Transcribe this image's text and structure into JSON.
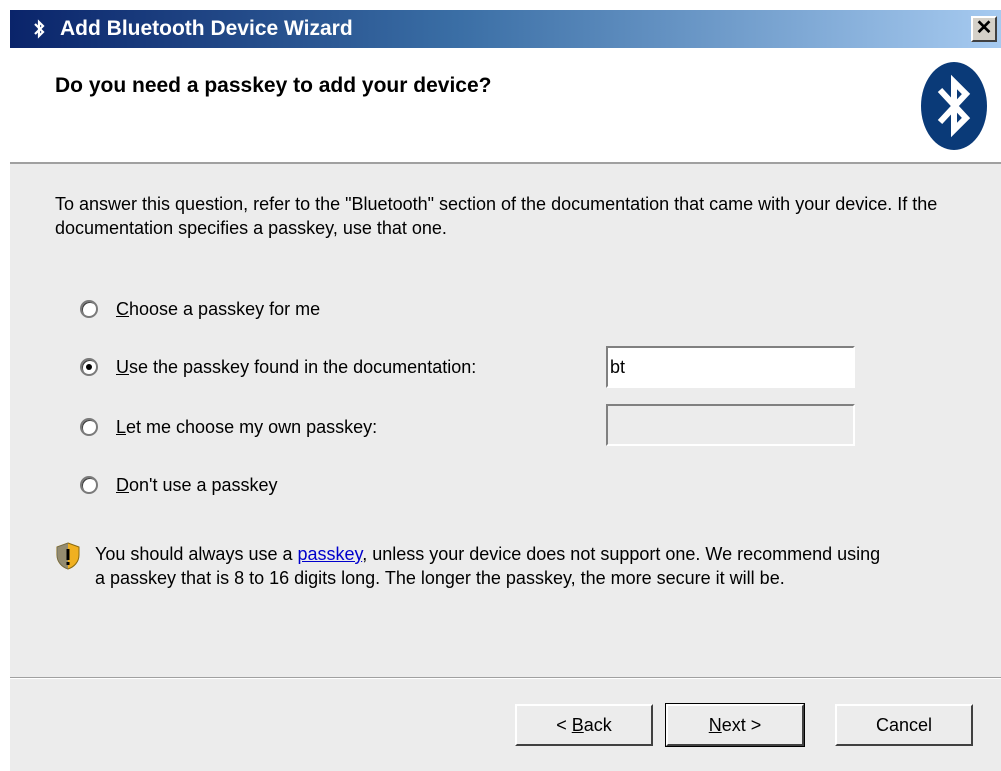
{
  "window": {
    "title": "Add Bluetooth Device Wizard",
    "close_glyph": "✕"
  },
  "header": {
    "question": "Do you need a passkey to add your device?",
    "logo_icon": "bluetooth-icon"
  },
  "body": {
    "intro": "To answer this question, refer to the \"Bluetooth\" section of the documentation that came with your device. If the documentation specifies a passkey, use that one.",
    "options": [
      {
        "accel": "C",
        "rest": "hoose a passkey for me",
        "checked": false
      },
      {
        "accel": "U",
        "rest": "se the passkey found in the documentation:",
        "checked": true
      },
      {
        "accel": "L",
        "rest": "et me choose my own passkey:",
        "checked": false
      },
      {
        "accel": "D",
        "pre": "",
        "rest": "on't use a passkey",
        "checked": false
      }
    ],
    "doc_passkey_value": "bt",
    "own_passkey_value": "",
    "notice_pre": "You should always use a ",
    "notice_link": "passkey",
    "notice_post": ", unless your device does not support one. We recommend using a passkey that is 8 to 16 digits long. The longer the passkey, the more secure it will be."
  },
  "footer": {
    "back_pre": "< ",
    "back_accel": "B",
    "back_rest": "ack",
    "next_accel": "N",
    "next_rest": "ext >",
    "cancel_label": "Cancel"
  },
  "colors": {
    "title_gradient_start": "#0a246a",
    "title_gradient_end": "#a6caf0",
    "bluetooth_blue": "#0a3a78",
    "window_bg": "#ececec",
    "link": "#0000cc"
  }
}
